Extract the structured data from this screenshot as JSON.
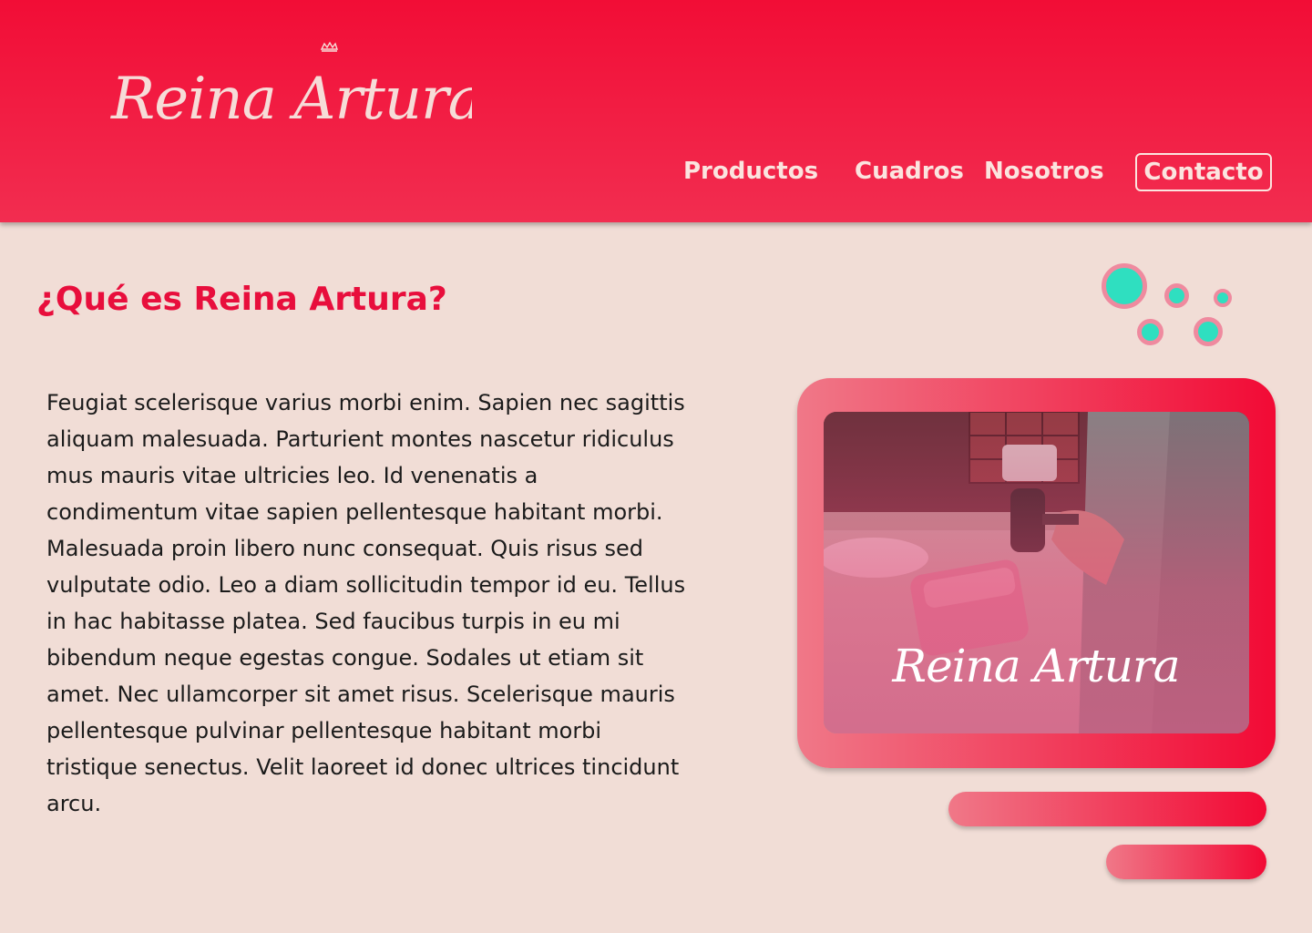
{
  "brand": {
    "name": "Reina Artura"
  },
  "nav": {
    "items": [
      {
        "label": "Productos"
      },
      {
        "label": "Cuadros"
      },
      {
        "label": "Nosotros"
      },
      {
        "label": "Contacto"
      }
    ]
  },
  "about": {
    "title": "¿Qué es Reina Artura?",
    "paragraph": "Feugiat scelerisque varius morbi enim. Sapien nec sagittis aliquam malesuada. Parturient montes nascetur ridiculus mus mauris vitae ultricies leo. Id venenatis a condimentum vitae sapien pellentesque habitant morbi. Malesuada proin libero nunc consequat. Quis risus sed vulputate odio. Leo a diam sollicitudin tempor id eu. Tellus in hac habitasse platea. Sed faucibus turpis in eu mi bibendum neque egestas congue. Sodales ut etiam sit amet. Nec ullamcorper sit amet risus. Scelerisque mauris pellentesque pulvinar pellentesque habitant morbi tristique senectus. Velit laoreet id donec ultrices tincidunt arcu.",
    "image_caption": "Reina Artura"
  },
  "colors": {
    "header": "#f20d36",
    "accent": "#e80e3c",
    "background": "#f1ddd6",
    "dots": "#2fdfc0",
    "nav_text": "#fbe4df"
  },
  "icons": {
    "logo": "crown-logo",
    "decoration": "dots-decoration"
  }
}
